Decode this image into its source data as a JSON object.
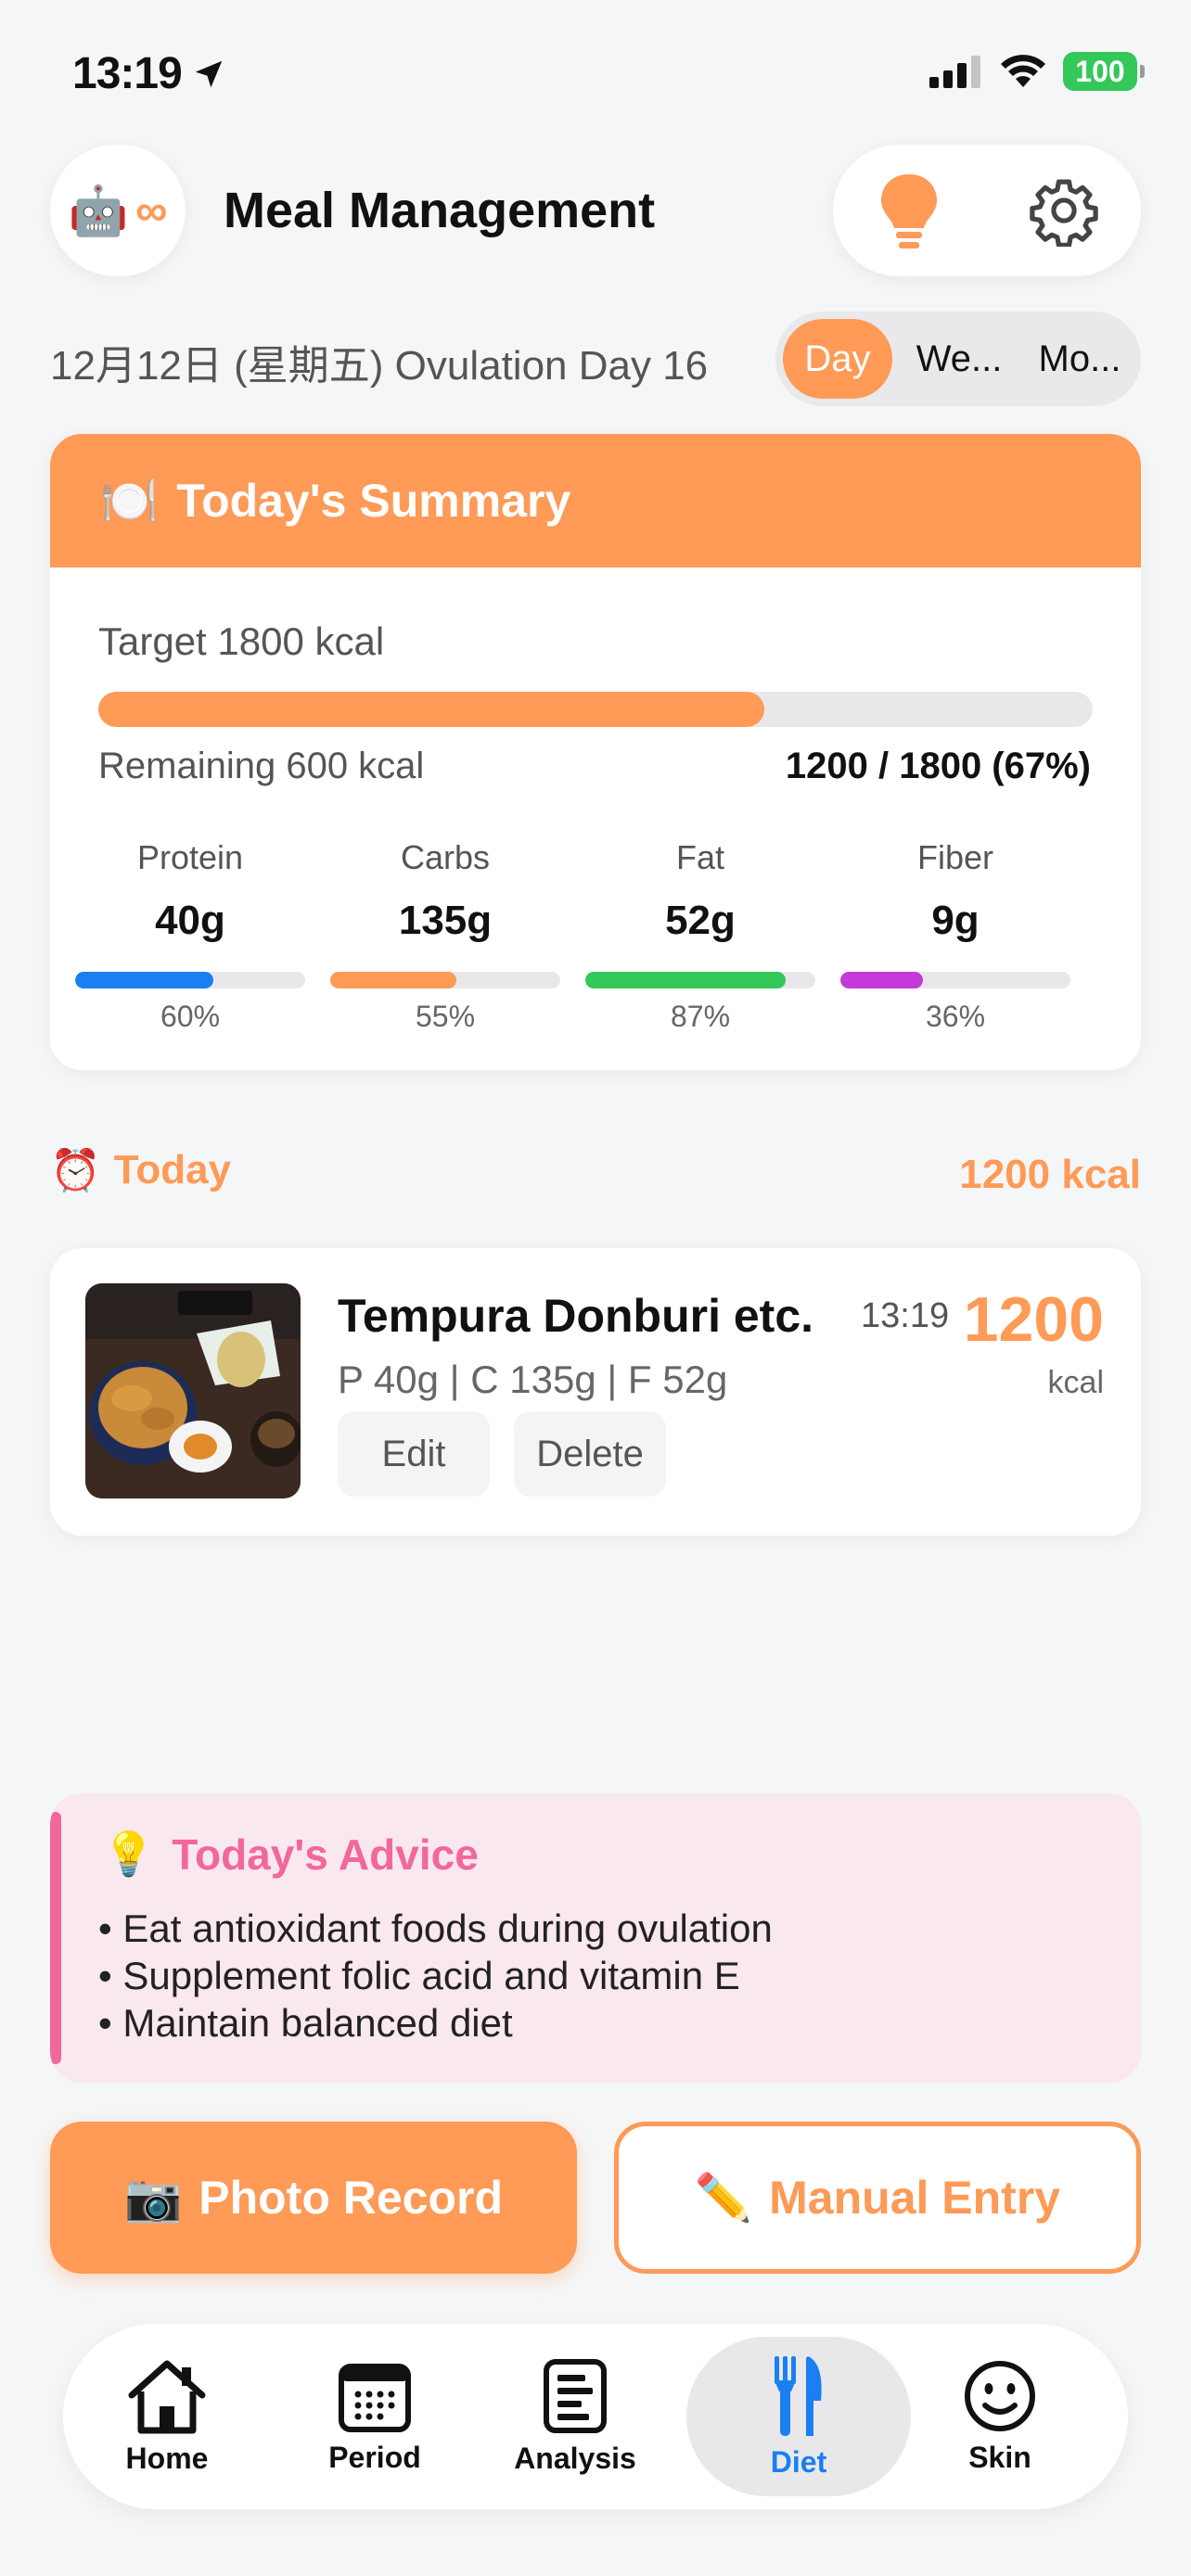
{
  "status_bar": {
    "time": "13:19",
    "battery": "100"
  },
  "header": {
    "robot_emoji": "🤖",
    "robot_badge": "∞",
    "title": "Meal Management"
  },
  "date_row": {
    "date_text": "12月12日 (星期五) Ovulation Day 16",
    "segments": [
      "Day",
      "We...",
      "Mo..."
    ],
    "selected": "Day"
  },
  "summary": {
    "icon": "🍽️",
    "title": "Today's Summary",
    "target": "Target 1800 kcal",
    "progress": 0.67,
    "remaining": "Remaining 600 kcal",
    "ratio": "1200 / 1800 (67%)",
    "macros": [
      {
        "label": "Protein",
        "value": "40g",
        "percent": "60%",
        "fraction": 0.6,
        "color": "#1a7ff0"
      },
      {
        "label": "Carbs",
        "value": "135g",
        "percent": "55%",
        "fraction": 0.55,
        "color": "#ff9a57"
      },
      {
        "label": "Fat",
        "value": "52g",
        "percent": "87%",
        "fraction": 0.87,
        "color": "#34c759"
      },
      {
        "label": "Fiber",
        "value": "9g",
        "percent": "36%",
        "fraction": 0.36,
        "color": "#c43ad8"
      }
    ]
  },
  "today": {
    "icon": "⏰",
    "label": "Today",
    "total": "1200 kcal"
  },
  "meal": {
    "name": "Tempura Donburi etc.",
    "time": "13:19",
    "calories": "1200",
    "unit": "kcal",
    "macros": "P 40g | C 135g | F 52g",
    "edit_label": "Edit",
    "delete_label": "Delete"
  },
  "advice": {
    "icon": "💡",
    "title": "Today's Advice",
    "items": [
      "• Eat antioxidant foods during ovulation",
      "• Supplement folic acid and vitamin E",
      "• Maintain balanced diet"
    ]
  },
  "actions": {
    "photo_icon": "📷",
    "photo_label": "Photo Record",
    "manual_icon": "✏️",
    "manual_label": "Manual Entry"
  },
  "tabbar": {
    "tabs": [
      {
        "label": "Home",
        "icon": "home-icon"
      },
      {
        "label": "Period",
        "icon": "calendar-icon"
      },
      {
        "label": "Analysis",
        "icon": "document-icon"
      },
      {
        "label": "Diet",
        "icon": "fork-knife-icon"
      },
      {
        "label": "Skin",
        "icon": "smiley-icon"
      }
    ],
    "active": "Diet"
  },
  "colors": {
    "accent": "#ff9a57",
    "advice_pink": "#f2679c",
    "active_tab": "#1a7ff0"
  }
}
